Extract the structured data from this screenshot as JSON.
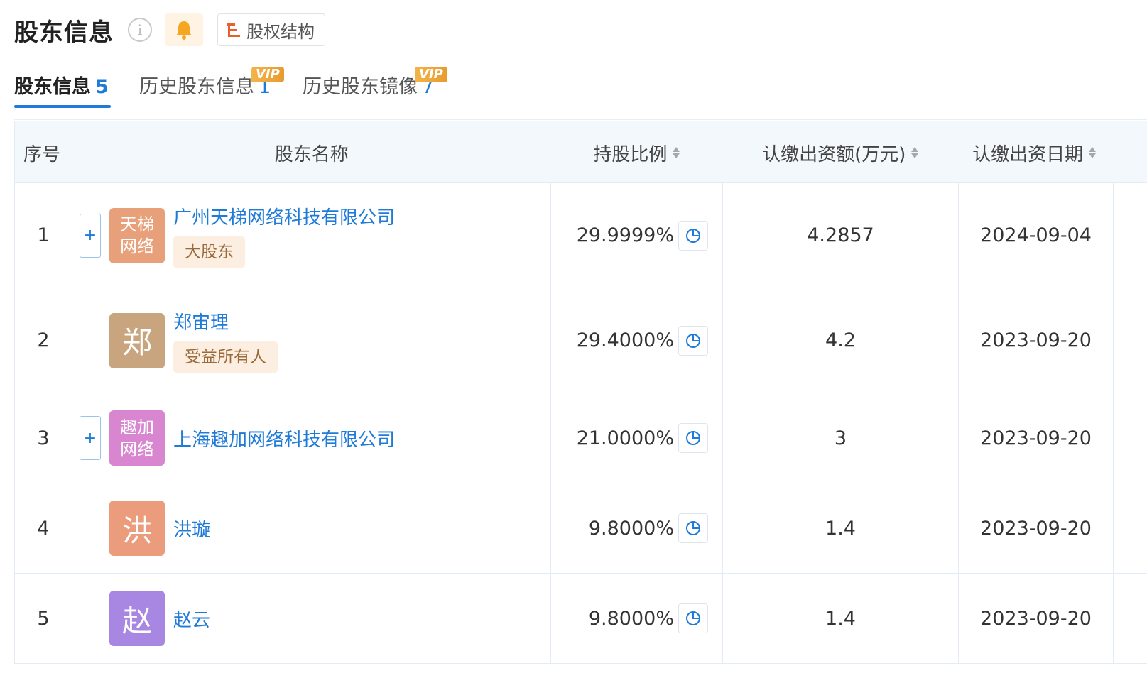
{
  "header": {
    "title": "股东信息",
    "equity_button_label": "股权结构",
    "icons": {
      "info": "info-icon",
      "bell": "bell-icon",
      "equity": "equity-structure-icon"
    },
    "colors": {
      "bell": "#f5a623",
      "equity_icon": "#e95f2b",
      "accent": "#1f7bd8"
    }
  },
  "tabs": [
    {
      "label": "股东信息",
      "count": "5",
      "active": true,
      "vip": false
    },
    {
      "label": "历史股东信息",
      "count": "1",
      "active": false,
      "vip": true,
      "vip_label": "VIP"
    },
    {
      "label": "历史股东镜像",
      "count": "7",
      "active": false,
      "vip": true,
      "vip_label": "VIP"
    }
  ],
  "table": {
    "columns": [
      {
        "label": "序号",
        "sortable": false
      },
      {
        "label": "股东名称",
        "sortable": false
      },
      {
        "label": "持股比例",
        "sortable": true
      },
      {
        "label": "认缴出资额(万元)",
        "sortable": true
      },
      {
        "label": "认缴出资日期",
        "sortable": true
      }
    ],
    "rows": [
      {
        "index": "1",
        "expandable": true,
        "logo_text": "天梯网络",
        "logo_color": "#e8a07a",
        "name": "广州天梯网络科技有限公司",
        "tag": "大股东",
        "percent": "29.9999%",
        "amount": "4.2857",
        "date": "2024-09-04"
      },
      {
        "index": "2",
        "expandable": false,
        "logo_text": "郑",
        "logo_color": "#c8a57f",
        "name": "郑宙理",
        "tag": "受益所有人",
        "percent": "29.4000%",
        "amount": "4.2",
        "date": "2023-09-20"
      },
      {
        "index": "3",
        "expandable": true,
        "logo_text": "趣加网络",
        "logo_color": "#d986d0",
        "name": "上海趣加网络科技有限公司",
        "tag": "",
        "percent": "21.0000%",
        "amount": "3",
        "date": "2023-09-20"
      },
      {
        "index": "4",
        "expandable": false,
        "logo_text": "洪",
        "logo_color": "#eb9c7c",
        "name": "洪璇",
        "tag": "",
        "percent": "9.8000%",
        "amount": "1.4",
        "date": "2023-09-20"
      },
      {
        "index": "5",
        "expandable": false,
        "logo_text": "赵",
        "logo_color": "#a887e3",
        "name": "赵云",
        "tag": "",
        "percent": "9.8000%",
        "amount": "1.4",
        "date": "2023-09-20"
      }
    ],
    "expand_symbol": "+",
    "pie_icon": "pie-chart-icon"
  }
}
